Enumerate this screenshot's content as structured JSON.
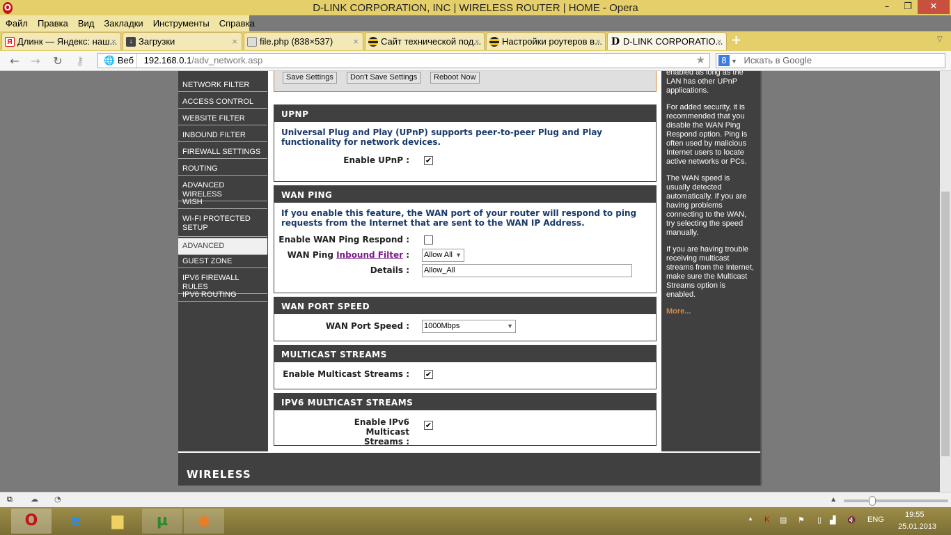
{
  "window": {
    "title": "D-LINK CORPORATION, INC | WIRELESS ROUTER | HOME - Opera",
    "logo": "O",
    "minimize": "–",
    "restore": "❐",
    "close": "✕"
  },
  "menu": [
    "Файл",
    "Правка",
    "Вид",
    "Закладки",
    "Инструменты",
    "Справка"
  ],
  "tabs": [
    {
      "label": "Длинк — Яндекс: наш...",
      "icon": "Я"
    },
    {
      "label": "Загрузки",
      "icon": "↓"
    },
    {
      "label": "file.php (838×537)",
      "icon": ""
    },
    {
      "label": "Сайт технической под...",
      "icon": ""
    },
    {
      "label": "Настройки роутеров в...",
      "icon": ""
    },
    {
      "label": "D-LINK CORPORATIO...",
      "icon": "D",
      "active": true
    }
  ],
  "tab_close": "×",
  "new_tab": "+",
  "address": {
    "badge": "Веб",
    "host": "192.168.0.1",
    "path": "/adv_network.asp",
    "search_placeholder": "Искать в Google",
    "search_engine": "8"
  },
  "sidebar": [
    "NETWORK FILTER",
    "ACCESS CONTROL",
    "WEBSITE FILTER",
    "INBOUND FILTER",
    "FIREWALL SETTINGS",
    "ROUTING",
    "ADVANCED WIRELESS",
    "WISH",
    "WI-FI PROTECTED SETUP",
    "ADVANCED NETWORK",
    "GUEST ZONE",
    "IPV6 FIREWALL RULES",
    "IPV6 ROUTING"
  ],
  "sidebar_selected": "ADVANCED NETWORK",
  "buttons": {
    "save": "Save Settings",
    "dont_save": "Don't Save Settings",
    "reboot": "Reboot Now"
  },
  "upnp": {
    "title": "UPNP",
    "desc": "Universal Plug and Play (UPnP) supports peer-to-peer Plug and Play functionality for network devices.",
    "label": "Enable UPnP :",
    "checked": true
  },
  "wan_ping": {
    "title": "WAN PING",
    "desc": "If you enable this feature, the WAN port of your router will respond to ping requests from the Internet that are sent to the WAN IP Address.",
    "respond_label": "Enable WAN Ping Respond :",
    "respond_checked": false,
    "filter_label_prefix": "WAN Ping ",
    "filter_link": "Inbound Filter",
    "filter_colon": " :",
    "filter_value": "Allow All",
    "details_label": "Details :",
    "details_value": "Allow_All"
  },
  "wan_speed": {
    "title": "WAN PORT SPEED",
    "label": "WAN Port Speed :",
    "value": "1000Mbps"
  },
  "multicast": {
    "title": "MULTICAST STREAMS",
    "label": "Enable Multicast Streams :",
    "checked": true
  },
  "ipv6_multicast": {
    "title": "IPV6 MULTICAST STREAMS",
    "label": "Enable IPv6 Multicast Streams :",
    "checked": true
  },
  "help": {
    "p0": "enabled as long as the LAN has other UPnP applications.",
    "p1": "For added security, it is recommended that you disable the WAN Ping Respond option. Ping is often used by malicious Internet users to locate active networks or PCs.",
    "p2": "The WAN speed is usually detected automatically. If you are having problems connecting to the WAN, try selecting the speed manually.",
    "p3": "If you are having trouble receiving multicast streams from the Internet, make sure the Multicast Streams option is enabled.",
    "more": "More..."
  },
  "footer": {
    "brand": "WIRELESS"
  },
  "tray": {
    "lang": "ENG",
    "time": "19:55",
    "date": "25.01.2013"
  },
  "colors": {
    "accent": "#e07a20",
    "dark": "#404040",
    "desc": "#1a3a6a"
  }
}
